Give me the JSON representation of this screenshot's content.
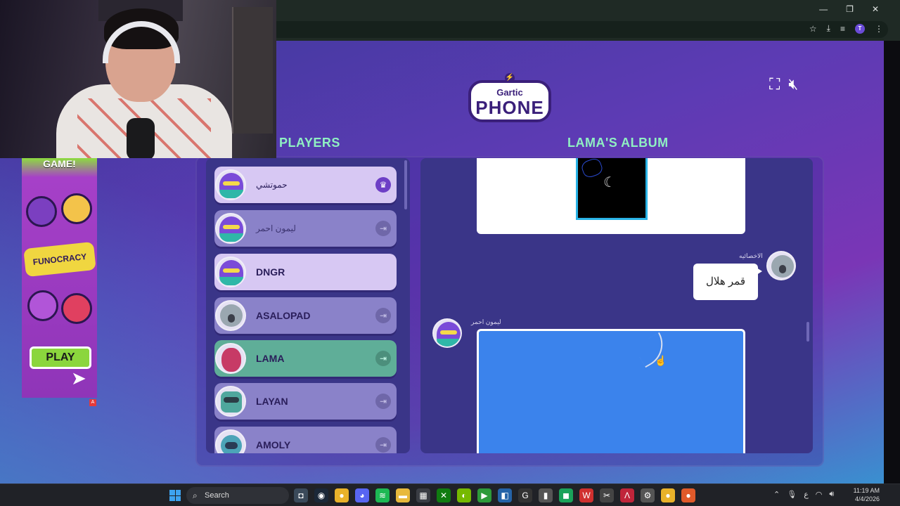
{
  "browser": {
    "window_controls": [
      "—",
      "❐",
      "✕"
    ],
    "toolbar_icons": [
      "star-icon",
      "download-icon",
      "playlist-icon",
      "profile-icon",
      "kebab-icon"
    ],
    "profile_initial": "T"
  },
  "game": {
    "logo_line1": "Gartic",
    "logo_line2": "PHONE",
    "players_heading": "PLAYERS",
    "album_heading": "LAMA'S ALBUM",
    "players": [
      {
        "name": "حموتشي",
        "avatar": "bird",
        "state": "host",
        "action": "crown"
      },
      {
        "name": "ليمون احمر",
        "avatar": "bird",
        "state": "dim",
        "action": "leave"
      },
      {
        "name": "DNGR",
        "avatar": "bird",
        "state": "highlight",
        "action": ""
      },
      {
        "name": "ASALOPAD",
        "avatar": "koala",
        "state": "normal",
        "action": "leave"
      },
      {
        "name": "LAMA",
        "avatar": "raspberry",
        "state": "active",
        "action": "leave"
      },
      {
        "name": "LAYAN",
        "avatar": "robot",
        "state": "normal",
        "action": "leave"
      },
      {
        "name": "AMOLY",
        "avatar": "bot",
        "state": "normal",
        "action": "leave"
      }
    ],
    "album": {
      "message_author": "الاخصائيه",
      "message_text": "قمر هلال",
      "drawing_author": "ليمون احمر"
    }
  },
  "ad": {
    "headline": "GAME!",
    "brand": "FUNOCRACY",
    "cta": "PLAY",
    "mark": "A"
  },
  "taskbar": {
    "search_placeholder": "Search",
    "time": "11:19 AM",
    "date": "4/4/2026",
    "lang": "ع"
  }
}
